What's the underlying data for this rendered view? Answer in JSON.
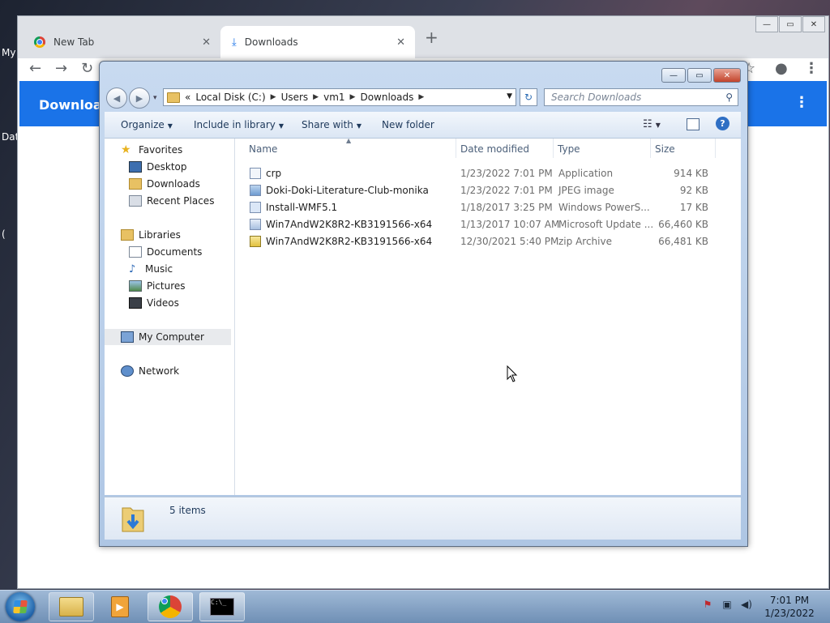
{
  "desktop": {
    "labels": [
      "My",
      "Dat",
      "("
    ]
  },
  "chrome": {
    "tabs": [
      {
        "label": "New Tab",
        "close": "✕"
      },
      {
        "label": "Downloads",
        "close": "✕"
      }
    ],
    "new_tab": "+",
    "page_title": "Download",
    "page_menu": "⋮"
  },
  "explorer": {
    "caption": {
      "min": "—",
      "max": "▭",
      "close": "✕"
    },
    "address": {
      "overflow": "«",
      "crumbs": [
        "Local Disk (C:)",
        "Users",
        "vm1",
        "Downloads"
      ]
    },
    "search": {
      "placeholder": "Search Downloads"
    },
    "commands": {
      "organize": "Organize",
      "include": "Include in library",
      "share": "Share with",
      "new_folder": "New folder"
    },
    "nav": {
      "favorites": "Favorites",
      "desktop": "Desktop",
      "downloads": "Downloads",
      "recent": "Recent Places",
      "libraries": "Libraries",
      "documents": "Documents",
      "music": "Music",
      "pictures": "Pictures",
      "videos": "Videos",
      "computer": "My Computer",
      "network": "Network"
    },
    "columns": {
      "name": "Name",
      "date": "Date modified",
      "type": "Type",
      "size": "Size"
    },
    "files": [
      {
        "name": "crp",
        "date": "1/23/2022 7:01 PM",
        "type": "Application",
        "size": "914 KB",
        "icon": "application-icon"
      },
      {
        "name": "Doki-Doki-Literature-Club-monika",
        "date": "1/23/2022 7:01 PM",
        "type": "JPEG image",
        "size": "92 KB",
        "icon": "image-file-icon"
      },
      {
        "name": "Install-WMF5.1",
        "date": "1/18/2017 3:25 PM",
        "type": "Windows PowerS...",
        "size": "17 KB",
        "icon": "powershell-file-icon"
      },
      {
        "name": "Win7AndW2K8R2-KB3191566-x64",
        "date": "1/13/2017 10:07 AM",
        "type": "Microsoft Update ...",
        "size": "66,460 KB",
        "icon": "update-file-icon"
      },
      {
        "name": "Win7AndW2K8R2-KB3191566-x64",
        "date": "12/30/2021 5:40 PM",
        "type": "zip Archive",
        "size": "66,481 KB",
        "icon": "zip-file-icon"
      }
    ],
    "status": "5 items"
  },
  "taskbar": {
    "clock_time": "7:01 PM",
    "clock_date": "1/23/2022"
  }
}
